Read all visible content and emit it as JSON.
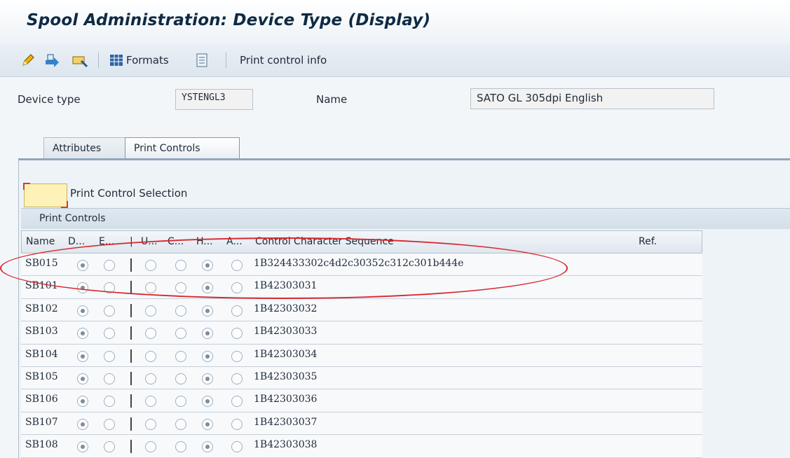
{
  "window": {
    "title": "Spool Administration: Device Type (Display)"
  },
  "toolbar": {
    "formats_label": "Formats",
    "print_control_info_label": "Print control info",
    "icons": [
      "pencil-icon",
      "transfer-icon",
      "where-used-icon",
      "formats-icon",
      "document-icon"
    ]
  },
  "header": {
    "device_type_label": "Device type",
    "device_type_value": "YSTENGL3",
    "name_label": "Name",
    "name_value": "SATO GL 305dpi English"
  },
  "tabs": [
    {
      "label": "Attributes",
      "active": false
    },
    {
      "label": "Print Controls",
      "active": true
    }
  ],
  "selection": {
    "label": "Print Control Selection"
  },
  "print_controls": {
    "group_title": "Print Controls",
    "columns": [
      "Name",
      "D...",
      "E...",
      "|",
      "U...",
      "C...",
      "H...",
      "A...",
      "Control Character Sequence",
      "Ref."
    ],
    "rows": [
      {
        "name": "SB015",
        "sequence": "1B324433302c4d2c30352c312c301b444e",
        "d": true,
        "e": false,
        "u": false,
        "c": false,
        "h": true,
        "a": false,
        "highlighted": true
      },
      {
        "name": "SB101",
        "sequence": "1B42303031",
        "d": true,
        "e": false,
        "u": false,
        "c": false,
        "h": true,
        "a": false
      },
      {
        "name": "SB102",
        "sequence": "1B42303032",
        "d": true,
        "e": false,
        "u": false,
        "c": false,
        "h": true,
        "a": false
      },
      {
        "name": "SB103",
        "sequence": "1B42303033",
        "d": true,
        "e": false,
        "u": false,
        "c": false,
        "h": true,
        "a": false
      },
      {
        "name": "SB104",
        "sequence": "1B42303034",
        "d": true,
        "e": false,
        "u": false,
        "c": false,
        "h": true,
        "a": false
      },
      {
        "name": "SB105",
        "sequence": "1B42303035",
        "d": true,
        "e": false,
        "u": false,
        "c": false,
        "h": true,
        "a": false
      },
      {
        "name": "SB106",
        "sequence": "1B42303036",
        "d": true,
        "e": false,
        "u": false,
        "c": false,
        "h": true,
        "a": false
      },
      {
        "name": "SB107",
        "sequence": "1B42303037",
        "d": true,
        "e": false,
        "u": false,
        "c": false,
        "h": true,
        "a": false
      },
      {
        "name": "SB108",
        "sequence": "1B42303038",
        "d": true,
        "e": false,
        "u": false,
        "c": false,
        "h": true,
        "a": false
      }
    ]
  },
  "colors": {
    "highlight_oval": "#d7282f",
    "title": "#0f2a44"
  }
}
